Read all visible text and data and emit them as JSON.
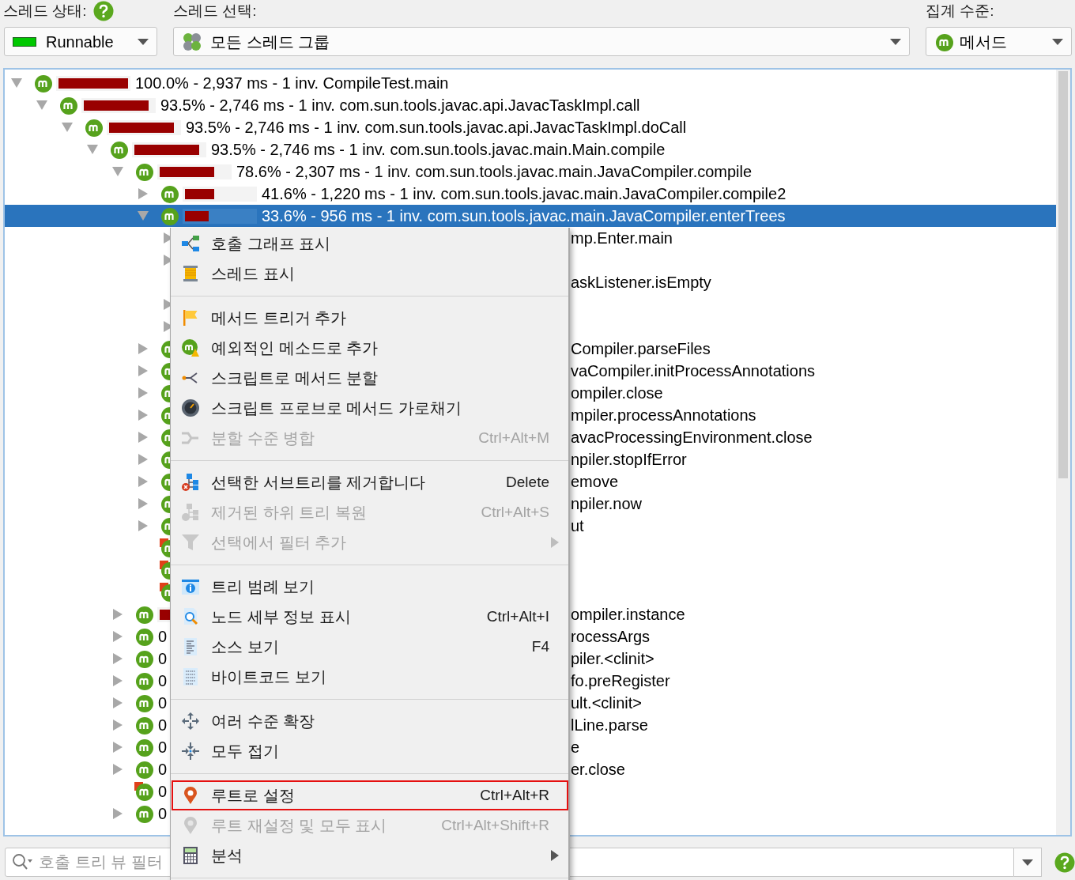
{
  "thread_status": {
    "label": "스레드 상태:",
    "value": "Runnable"
  },
  "thread_select": {
    "label": "스레드 선택:",
    "value": "모든 스레드 그룹"
  },
  "aggregation": {
    "label": "집계 수준:",
    "value": "메서드"
  },
  "tree": [
    {
      "leaf": false,
      "expanded": true,
      "selected": false,
      "marked": false,
      "level": 1.0,
      "label": "100.0% - 2,937 ms - 1 inv. CompileTest.main",
      "children": [
        {
          "leaf": false,
          "expanded": true,
          "selected": false,
          "marked": false,
          "level": 0.935,
          "label": "93.5% - 2,746 ms - 1 inv. com.sun.tools.javac.api.JavacTaskImpl.call",
          "children": [
            {
              "leaf": false,
              "expanded": true,
              "selected": false,
              "marked": false,
              "level": 0.935,
              "label": "93.5% - 2,746 ms - 1 inv. com.sun.tools.javac.api.JavacTaskImpl.doCall",
              "children": [
                {
                  "leaf": false,
                  "expanded": true,
                  "selected": false,
                  "marked": false,
                  "level": 0.935,
                  "label": "93.5% - 2,746 ms - 1 inv. com.sun.tools.javac.main.Main.compile",
                  "children": [
                    {
                      "leaf": false,
                      "expanded": true,
                      "selected": false,
                      "marked": false,
                      "level": 0.786,
                      "label": "78.6% - 2,307 ms - 1 inv. com.sun.tools.javac.main.JavaCompiler.compile",
                      "children": [
                        {
                          "leaf": false,
                          "expanded": false,
                          "selected": false,
                          "marked": false,
                          "level": 0.416,
                          "label": "41.6% - 1,220 ms - 1 inv. com.sun.tools.javac.main.JavaCompiler.compile2"
                        },
                        {
                          "leaf": false,
                          "expanded": true,
                          "selected": true,
                          "marked": false,
                          "level": 0.336,
                          "label": "33.6% - 956 ms - 1 inv. com.sun.tools.javac.main.JavaCompiler.enterTrees",
                          "children": [
                            {
                              "leaf": false,
                              "expanded": false,
                              "selected": false,
                              "tail": "mp.Enter.main"
                            },
                            {
                              "leaf": false,
                              "expanded": false,
                              "selected": false
                            },
                            {
                              "leaf": true,
                              "selected": false,
                              "tail": "askListener.isEmpty"
                            },
                            {
                              "leaf": false,
                              "expanded": false,
                              "selected": false
                            },
                            {
                              "leaf": false,
                              "expanded": false,
                              "selected": false
                            }
                          ]
                        },
                        {
                          "leaf": false,
                          "expanded": false,
                          "selected": false,
                          "marked": false,
                          "tail": "Compiler.parseFiles"
                        },
                        {
                          "leaf": false,
                          "expanded": false,
                          "selected": false,
                          "marked": false,
                          "tail": "vaCompiler.initProcessAnnotations"
                        },
                        {
                          "leaf": false,
                          "expanded": false,
                          "selected": false,
                          "marked": false,
                          "tail": "ompiler.close"
                        },
                        {
                          "leaf": false,
                          "expanded": false,
                          "selected": false,
                          "marked": false,
                          "tail": "mpiler.processAnnotations"
                        },
                        {
                          "leaf": false,
                          "expanded": false,
                          "selected": false,
                          "marked": false,
                          "tail": "avacProcessingEnvironment.close"
                        },
                        {
                          "leaf": false,
                          "expanded": false,
                          "selected": false,
                          "marked": false,
                          "tail": "npiler.stopIfError"
                        },
                        {
                          "leaf": false,
                          "expanded": false,
                          "selected": false,
                          "marked": false,
                          "tail": "emove"
                        },
                        {
                          "leaf": false,
                          "expanded": false,
                          "selected": false,
                          "marked": false,
                          "tail": "npiler.now"
                        },
                        {
                          "leaf": false,
                          "expanded": false,
                          "selected": false,
                          "marked": false,
                          "tail": "ut"
                        },
                        {
                          "leaf": true,
                          "selected": false,
                          "marked": true
                        },
                        {
                          "leaf": true,
                          "selected": false,
                          "marked": true
                        },
                        {
                          "leaf": true,
                          "selected": false,
                          "marked": true
                        }
                      ]
                    },
                    {
                      "leaf": false,
                      "expanded": false,
                      "selected": false,
                      "marked": false,
                      "level": 0.2,
                      "tail": "ompiler.instance"
                    },
                    {
                      "leaf": false,
                      "expanded": false,
                      "selected": false,
                      "marked": false,
                      "label": "0",
                      "tail": "rocessArgs"
                    },
                    {
                      "leaf": false,
                      "expanded": false,
                      "selected": false,
                      "marked": false,
                      "label": "0",
                      "tail": "piler.<clinit>"
                    },
                    {
                      "leaf": false,
                      "expanded": false,
                      "selected": false,
                      "marked": false,
                      "label": "0",
                      "tail": "fo.preRegister"
                    },
                    {
                      "leaf": false,
                      "expanded": false,
                      "selected": false,
                      "marked": false,
                      "label": "0",
                      "tail": "ult.<clinit>"
                    },
                    {
                      "leaf": false,
                      "expanded": false,
                      "selected": false,
                      "marked": false,
                      "label": "0",
                      "tail": "lLine.parse"
                    },
                    {
                      "leaf": false,
                      "expanded": false,
                      "selected": false,
                      "marked": false,
                      "label": "0",
                      "tail": "e"
                    },
                    {
                      "leaf": false,
                      "expanded": false,
                      "selected": false,
                      "marked": false,
                      "label": "0",
                      "tail": "er.close"
                    },
                    {
                      "leaf": true,
                      "selected": false,
                      "marked": true,
                      "label": "0"
                    },
                    {
                      "leaf": false,
                      "expanded": false,
                      "selected": false,
                      "marked": false,
                      "label": "0"
                    }
                  ]
                }
              ]
            }
          ]
        }
      ]
    }
  ],
  "menu": {
    "items": [
      {
        "kind": "item",
        "label": "호출 그래프 표시",
        "disabled": false,
        "submenu": false,
        "highlighted": false
      },
      {
        "kind": "item",
        "label": "스레드 표시",
        "disabled": false,
        "submenu": false,
        "highlighted": false
      },
      {
        "kind": "separator"
      },
      {
        "kind": "item",
        "label": "메서드 트리거 추가",
        "disabled": false,
        "submenu": false,
        "highlighted": false
      },
      {
        "kind": "item",
        "label": "예외적인 메소드로 추가",
        "disabled": false,
        "submenu": false,
        "highlighted": false
      },
      {
        "kind": "item",
        "label": "스크립트로 메서드 분할",
        "disabled": false,
        "submenu": false,
        "highlighted": false
      },
      {
        "kind": "item",
        "label": "스크립트 프로브로 메서드 가로채기",
        "disabled": false,
        "submenu": false,
        "highlighted": false
      },
      {
        "kind": "item",
        "label": "분할 수준 병합",
        "shortcut": "Ctrl+Alt+M",
        "disabled": true,
        "submenu": false,
        "highlighted": false
      },
      {
        "kind": "separator"
      },
      {
        "kind": "item",
        "label": "선택한 서브트리를 제거합니다",
        "shortcut": "Delete",
        "disabled": false,
        "submenu": false,
        "highlighted": false
      },
      {
        "kind": "item",
        "label": "제거된 하위 트리 복원",
        "shortcut": "Ctrl+Alt+S",
        "disabled": true,
        "submenu": false,
        "highlighted": false
      },
      {
        "kind": "item",
        "label": "선택에서 필터 추가",
        "disabled": true,
        "submenu": true,
        "highlighted": false
      },
      {
        "kind": "separator"
      },
      {
        "kind": "item",
        "label": "트리 범례 보기",
        "disabled": false,
        "submenu": false,
        "highlighted": false
      },
      {
        "kind": "item",
        "label": "노드 세부 정보 표시",
        "shortcut": "Ctrl+Alt+I",
        "disabled": false,
        "submenu": false,
        "highlighted": false
      },
      {
        "kind": "item",
        "label": "소스 보기",
        "shortcut": "F4",
        "disabled": false,
        "submenu": false,
        "highlighted": false
      },
      {
        "kind": "item",
        "label": "바이트코드 보기",
        "disabled": false,
        "submenu": false,
        "highlighted": false
      },
      {
        "kind": "separator"
      },
      {
        "kind": "item",
        "label": "여러 수준 확장",
        "disabled": false,
        "submenu": false,
        "highlighted": false
      },
      {
        "kind": "item",
        "label": "모두 접기",
        "disabled": false,
        "submenu": false,
        "highlighted": false
      },
      {
        "kind": "separator"
      },
      {
        "kind": "item",
        "label": "루트로 설정",
        "shortcut": "Ctrl+Alt+R",
        "disabled": false,
        "submenu": false,
        "highlighted": true
      },
      {
        "kind": "item",
        "label": "루트 재설정 및 모두 표시",
        "shortcut": "Ctrl+Alt+Shift+R",
        "disabled": true,
        "submenu": false,
        "highlighted": false
      },
      {
        "kind": "item",
        "label": "분석",
        "disabled": false,
        "submenu": true,
        "highlighted": false
      },
      {
        "kind": "separator"
      }
    ]
  },
  "filter": {
    "placeholder": "호출 트리 뷰 필터"
  }
}
